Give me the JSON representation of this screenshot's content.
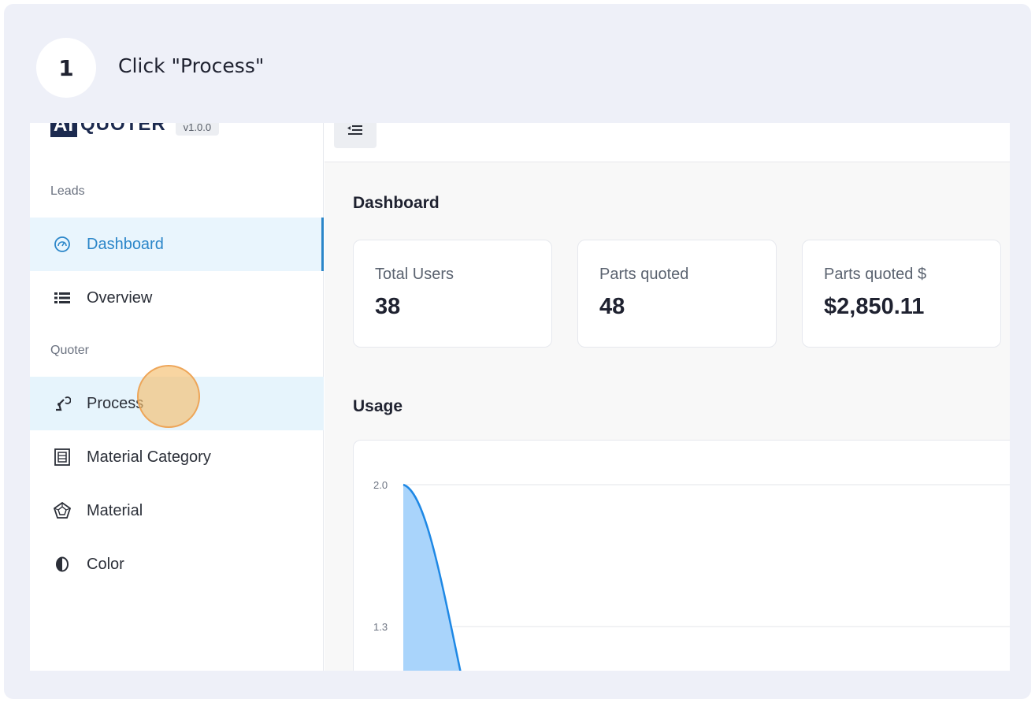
{
  "step": {
    "number": "1",
    "instruction": "Click \"Process\""
  },
  "app": {
    "logo_ai": "AI",
    "logo_name": "QUOTER",
    "version": "v1.0.0"
  },
  "sidebar": {
    "sections": [
      {
        "label": "Leads"
      },
      {
        "label": "Quoter"
      }
    ],
    "items": [
      {
        "label": "Dashboard",
        "icon": "gauge-icon",
        "active": true
      },
      {
        "label": "Overview",
        "icon": "list-icon"
      },
      {
        "label": "Process",
        "icon": "robot-arm-icon"
      },
      {
        "label": "Material Category",
        "icon": "category-box-icon"
      },
      {
        "label": "Material",
        "icon": "gem-icon"
      },
      {
        "label": "Color",
        "icon": "contrast-icon"
      }
    ]
  },
  "main": {
    "title": "Dashboard",
    "stats": [
      {
        "label": "Total Users",
        "value": "38"
      },
      {
        "label": "Parts quoted",
        "value": "48"
      },
      {
        "label": "Parts quoted $",
        "value": "$2,850.11"
      }
    ],
    "usage_title": "Usage"
  },
  "chart_data": {
    "type": "area",
    "y_ticks": [
      "2.0",
      "1.3"
    ],
    "series": [
      {
        "values": [
          2.0,
          1.3
        ]
      }
    ],
    "color": "#1e88e5",
    "fill": "#a9d4fb"
  }
}
